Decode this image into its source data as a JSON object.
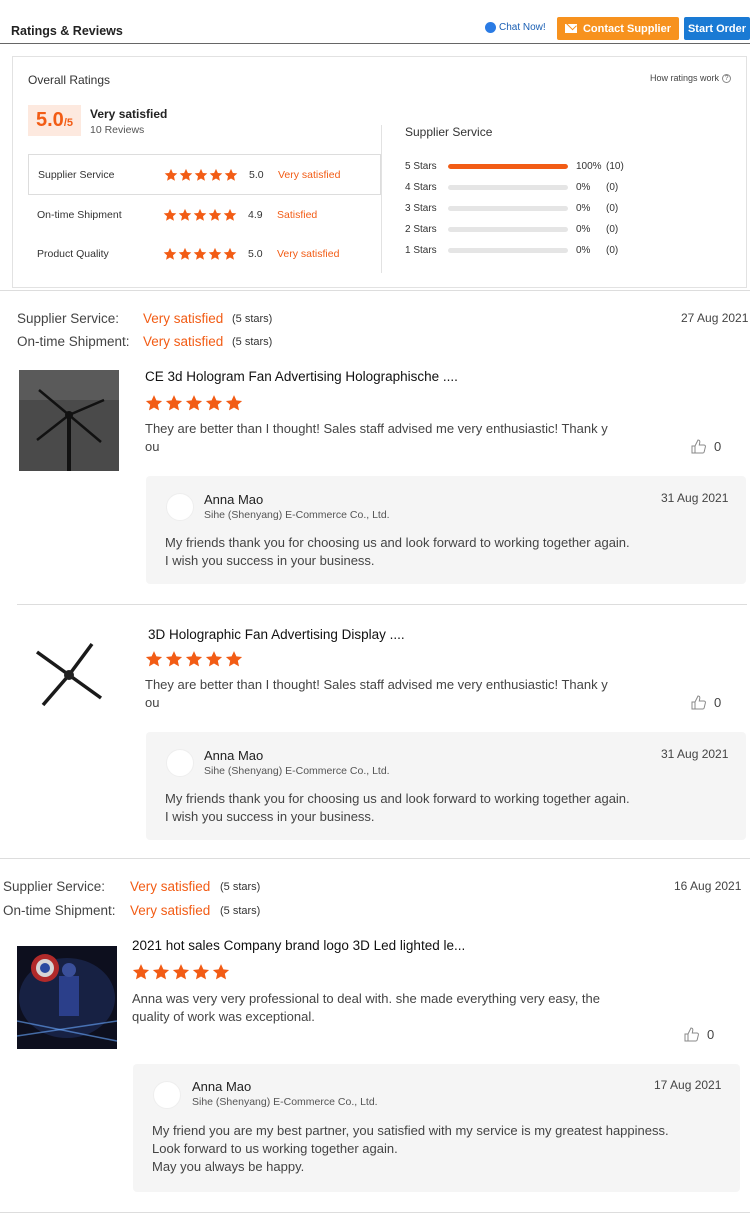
{
  "header": {
    "title": "Ratings & Reviews",
    "chat_label": "Chat Now!",
    "contact_label": "Contact Supplier",
    "start_label": "Start Order"
  },
  "overall": {
    "title": "Overall Ratings",
    "how_label": "How ratings work",
    "score": "5.0",
    "score_max": "/5",
    "summary": "Very satisfied",
    "review_count": "10 Reviews",
    "categories": [
      {
        "label": "Supplier Service",
        "score": "5.0",
        "satisfaction": "Very satisfied"
      },
      {
        "label": "On-time Shipment",
        "score": "4.9",
        "satisfaction": "Satisfied"
      },
      {
        "label": "Product Quality",
        "score": "5.0",
        "satisfaction": "Very satisfied"
      }
    ],
    "breakdown_title": "Supplier Service",
    "breakdown": [
      {
        "label": "5 Stars",
        "fraction": 1.0,
        "percent": "100%",
        "count": "(10)"
      },
      {
        "label": "4 Stars",
        "fraction": 0.0,
        "percent": "0%",
        "count": "(0)"
      },
      {
        "label": "3 Stars",
        "fraction": 0.0,
        "percent": "0%",
        "count": "(0)"
      },
      {
        "label": "2 Stars",
        "fraction": 0.0,
        "percent": "0%",
        "count": "(0)"
      },
      {
        "label": "1 Stars",
        "fraction": 0.0,
        "percent": "0%",
        "count": "(0)"
      }
    ]
  },
  "reviews": [
    {
      "date": "27 Aug 2021",
      "service_label": "Supplier Service:",
      "service_value": "Very satisfied",
      "service_stars": "(5 stars)",
      "shipment_label": "On-time Shipment:",
      "shipment_value": "Very satisfied",
      "shipment_stars": "(5 stars)",
      "items": [
        {
          "product": "CE 3d Hologram Fan Advertising Holographische ....",
          "text_line1": "They are better than I thought!  Sales staff advised me very enthusiastic!  Thank y",
          "text_line2": "ou",
          "likes": "0",
          "reply": {
            "name": "Anna Mao",
            "company": "Sihe (Shenyang) E-Commerce Co., Ltd.",
            "date": "31 Aug 2021",
            "line1": "My friends thank you for choosing us and look forward to working together again.",
            "line2": "I wish you success in your business."
          }
        },
        {
          "product": "3D Holographic Fan Advertising Display ....",
          "text_line1": "They are better than I thought!  Sales staff advised me very enthusiastic!  Thank y",
          "text_line2": "ou",
          "likes": "0",
          "reply": {
            "name": "Anna Mao",
            "company": "Sihe (Shenyang) E-Commerce Co., Ltd.",
            "date": "31 Aug 2021",
            "line1": "My friends thank you for choosing us and look forward to working together again.",
            "line2": "I wish you success in your business."
          }
        }
      ]
    },
    {
      "date": "16 Aug 2021",
      "service_label": "Supplier Service:",
      "service_value": "Very satisfied",
      "service_stars": "(5 stars)",
      "shipment_label": "On-time Shipment:",
      "shipment_value": "Very satisfied",
      "shipment_stars": "(5 stars)",
      "items": [
        {
          "product": "2021 hot sales Company brand logo 3D Led lighted le...",
          "text_line1": "Anna was very very professional to deal with. she made everything very easy, the",
          "text_line2": "quality of work was exceptional.",
          "likes": "0",
          "reply": {
            "name": "Anna Mao",
            "company": "Sihe (Shenyang) E-Commerce Co., Ltd.",
            "date": "17 Aug 2021",
            "line1": "My friend you are my best partner, you satisfied with my service is my greatest happiness.",
            "line2": "Look forward to us working together again.",
            "line3": "May you always be happy."
          }
        }
      ]
    }
  ],
  "colors": {
    "accent": "#f25c15",
    "contact_button": "#f7921e",
    "start_button": "#1a7ad4"
  }
}
